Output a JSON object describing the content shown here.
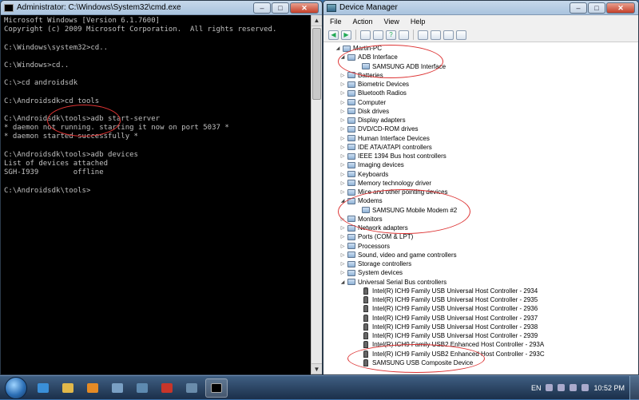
{
  "cmd": {
    "title": "Administrator: C:\\Windows\\System32\\cmd.exe",
    "lines": [
      "Microsoft Windows [Version 6.1.7600]",
      "Copyright (c) 2009 Microsoft Corporation.  All rights reserved.",
      "",
      "C:\\Windows\\system32>cd..",
      "",
      "C:\\Windows>cd..",
      "",
      "C:\\>cd androidsdk",
      "",
      "C:\\Androidsdk>cd tools",
      "",
      "C:\\Androidsdk\\tools>adb start-server",
      "* daemon not running. starting it now on port 5037 *",
      "* daemon started successfully *",
      "",
      "C:\\Androidsdk\\tools>adb devices",
      "List of devices attached",
      "SGH-I939        offline",
      "",
      "C:\\Androidsdk\\tools>"
    ]
  },
  "dm": {
    "title": "Device Manager",
    "menu": [
      "File",
      "Action",
      "View",
      "Help"
    ],
    "tree": [
      {
        "label": "Martin-PC",
        "level": 0,
        "exp": "◢"
      },
      {
        "label": "ADB Interface",
        "level": 1,
        "exp": "◢"
      },
      {
        "label": "SAMSUNG ADB Interface",
        "level": 2,
        "exp": ""
      },
      {
        "label": "Batteries",
        "level": 1,
        "exp": "▷"
      },
      {
        "label": "Biometric Devices",
        "level": 1,
        "exp": "▷"
      },
      {
        "label": "Bluetooth Radios",
        "level": 1,
        "exp": "▷"
      },
      {
        "label": "Computer",
        "level": 1,
        "exp": "▷"
      },
      {
        "label": "Disk drives",
        "level": 1,
        "exp": "▷"
      },
      {
        "label": "Display adapters",
        "level": 1,
        "exp": "▷"
      },
      {
        "label": "DVD/CD-ROM drives",
        "level": 1,
        "exp": "▷"
      },
      {
        "label": "Human Interface Devices",
        "level": 1,
        "exp": "▷"
      },
      {
        "label": "IDE ATA/ATAPI controllers",
        "level": 1,
        "exp": "▷"
      },
      {
        "label": "IEEE 1394 Bus host controllers",
        "level": 1,
        "exp": "▷"
      },
      {
        "label": "Imaging devices",
        "level": 1,
        "exp": "▷"
      },
      {
        "label": "Keyboards",
        "level": 1,
        "exp": "▷"
      },
      {
        "label": "Memory technology driver",
        "level": 1,
        "exp": "▷"
      },
      {
        "label": "Mice and other pointing devices",
        "level": 1,
        "exp": "▷"
      },
      {
        "label": "Modems",
        "level": 1,
        "exp": "◢"
      },
      {
        "label": "SAMSUNG Mobile Modem #2",
        "level": 2,
        "exp": ""
      },
      {
        "label": "Monitors",
        "level": 1,
        "exp": "▷"
      },
      {
        "label": "Network adapters",
        "level": 1,
        "exp": "▷"
      },
      {
        "label": "Ports (COM & LPT)",
        "level": 1,
        "exp": "▷"
      },
      {
        "label": "Processors",
        "level": 1,
        "exp": "▷"
      },
      {
        "label": "Sound, video and game controllers",
        "level": 1,
        "exp": "▷"
      },
      {
        "label": "Storage controllers",
        "level": 1,
        "exp": "▷"
      },
      {
        "label": "System devices",
        "level": 1,
        "exp": "▷"
      },
      {
        "label": "Universal Serial Bus controllers",
        "level": 1,
        "exp": "◢"
      },
      {
        "label": "Intel(R) ICH9 Family USB Universal Host Controller - 2934",
        "level": 2,
        "exp": "",
        "usb": true
      },
      {
        "label": "Intel(R) ICH9 Family USB Universal Host Controller - 2935",
        "level": 2,
        "exp": "",
        "usb": true
      },
      {
        "label": "Intel(R) ICH9 Family USB Universal Host Controller - 2936",
        "level": 2,
        "exp": "",
        "usb": true
      },
      {
        "label": "Intel(R) ICH9 Family USB Universal Host Controller - 2937",
        "level": 2,
        "exp": "",
        "usb": true
      },
      {
        "label": "Intel(R) ICH9 Family USB Universal Host Controller - 2938",
        "level": 2,
        "exp": "",
        "usb": true
      },
      {
        "label": "Intel(R) ICH9 Family USB Universal Host Controller - 2939",
        "level": 2,
        "exp": "",
        "usb": true
      },
      {
        "label": "Intel(R) ICH9 Family USB2 Enhanced Host Controller - 293A",
        "level": 2,
        "exp": "",
        "usb": true
      },
      {
        "label": "Intel(R) ICH9 Family USB2 Enhanced Host Controller - 293C",
        "level": 2,
        "exp": "",
        "usb": true
      },
      {
        "label": "SAMSUNG USB Composite Device",
        "level": 2,
        "exp": "",
        "usb": true
      }
    ]
  },
  "taskbar": {
    "language": "EN",
    "time": "10:52 PM"
  },
  "colors": {
    "annotation": "#dd3333",
    "console_text": "#c0c0c0",
    "console_bg": "#000000"
  }
}
